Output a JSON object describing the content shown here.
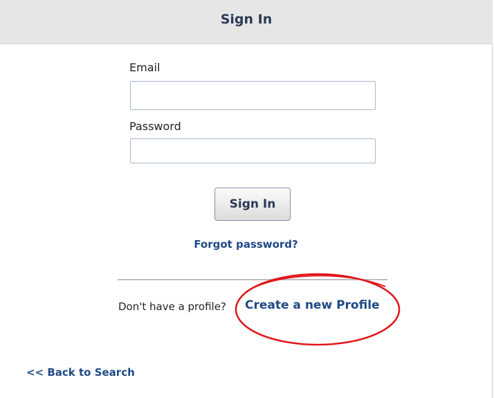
{
  "header": {
    "title": "Sign In"
  },
  "form": {
    "email_label": "Email",
    "email_value": "",
    "password_label": "Password",
    "password_value": "",
    "submit_label": "Sign In",
    "forgot_label": "Forgot password?"
  },
  "profile": {
    "prompt": "Don't have a profile?",
    "create_label": "Create a new Profile"
  },
  "nav": {
    "back_label": "<< Back to Search"
  },
  "colors": {
    "header_bg": "#e6e6e6",
    "link": "#1f4a86",
    "annotation": "#e0161b"
  }
}
